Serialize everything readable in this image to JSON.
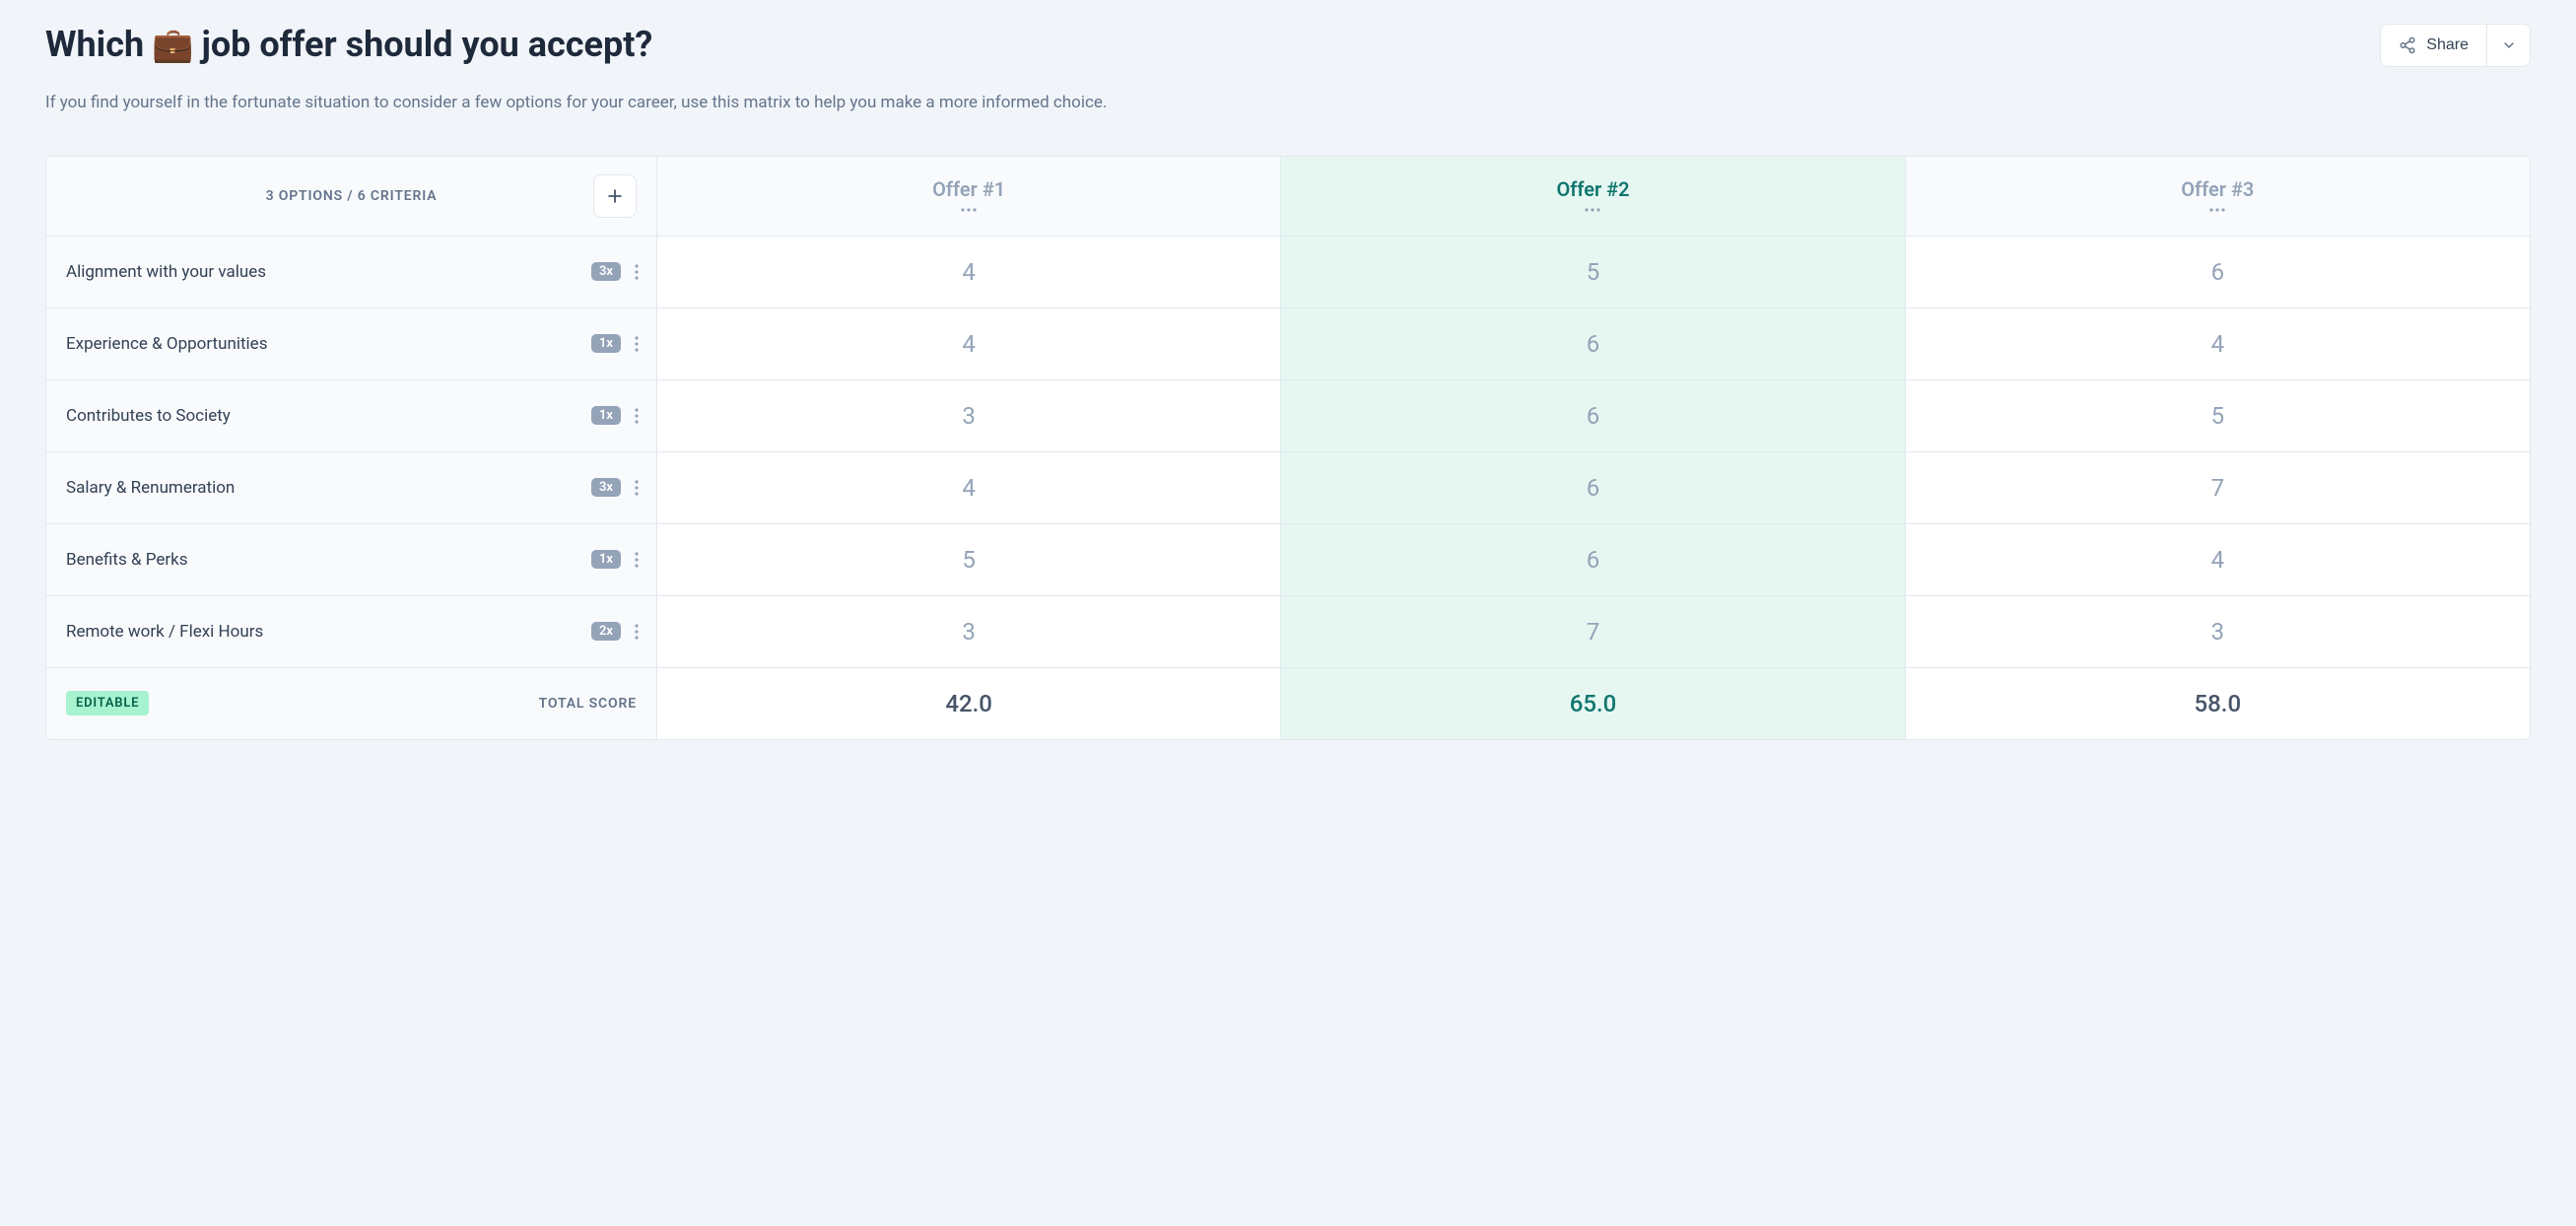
{
  "header": {
    "title_before": "Which",
    "emoji": "💼",
    "title_after": "job offer should you accept?",
    "share_label": "Share"
  },
  "subtitle": "If you find yourself in the fortunate situation to consider a few options for your career, use this matrix to help you make a more informed choice.",
  "matrix": {
    "summary_label": "3 OPTIONS / 6 CRITERIA",
    "total_label": "TOTAL SCORE",
    "editable_label": "EDITABLE",
    "best_index": 1,
    "options": [
      {
        "name": "Offer #1",
        "total": "42.0"
      },
      {
        "name": "Offer #2",
        "total": "65.0"
      },
      {
        "name": "Offer #3",
        "total": "58.0"
      }
    ],
    "criteria": [
      {
        "label": "Alignment with your values",
        "weight": "3x",
        "scores": [
          "4",
          "5",
          "6"
        ]
      },
      {
        "label": "Experience & Opportunities",
        "weight": "1x",
        "scores": [
          "4",
          "6",
          "4"
        ]
      },
      {
        "label": "Contributes to Society",
        "weight": "1x",
        "scores": [
          "3",
          "6",
          "5"
        ]
      },
      {
        "label": "Salary & Renumeration",
        "weight": "3x",
        "scores": [
          "4",
          "6",
          "7"
        ]
      },
      {
        "label": "Benefits & Perks",
        "weight": "1x",
        "scores": [
          "5",
          "6",
          "4"
        ]
      },
      {
        "label": "Remote work / Flexi Hours",
        "weight": "2x",
        "scores": [
          "3",
          "7",
          "3"
        ]
      }
    ]
  }
}
